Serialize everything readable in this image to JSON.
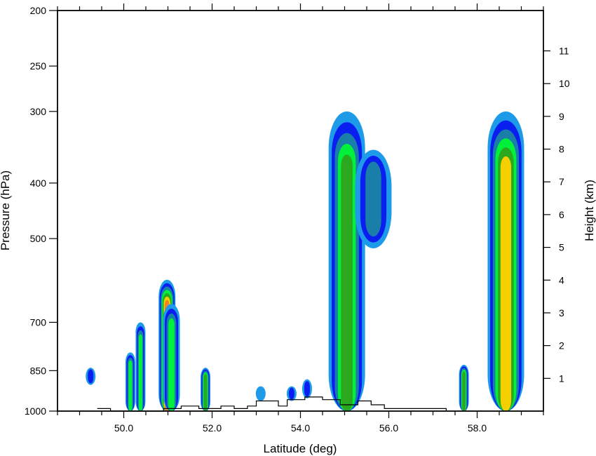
{
  "chart_data": {
    "type": "area",
    "xlabel": "Latitude (deg)",
    "ylabel": "Pressure (hPa)",
    "y2label": "Height (km)",
    "xlim": [
      48.5,
      59.5
    ],
    "ylim": [
      1000,
      200
    ],
    "y_scale": "log",
    "x_ticks": [
      "50.0",
      "52.0",
      "54.0",
      "56.0",
      "58.0"
    ],
    "x_tick_values": [
      50,
      52,
      54,
      56,
      58
    ],
    "y_ticks": [
      "200",
      "250",
      "300",
      "400",
      "500",
      "700",
      "850",
      "1000"
    ],
    "y_tick_values": [
      200,
      250,
      300,
      400,
      500,
      700,
      850,
      1000
    ],
    "y2_ticks": [
      "1",
      "2",
      "3",
      "4",
      "5",
      "6",
      "7",
      "8",
      "9",
      "10",
      "11"
    ],
    "y2_tick_values": [
      1,
      2,
      3,
      4,
      5,
      6,
      7,
      8,
      9,
      10,
      11
    ],
    "grid": false,
    "legend": "none",
    "colors": [
      "#1e9be8",
      "#0a1ef0",
      "#1a7fa8",
      "#00f03c",
      "#2ca81e",
      "#f5d000",
      "#f08228"
    ],
    "terrain_color": "#000000",
    "blobs": [
      {
        "center_lat": 49.25,
        "bottom_p": 900,
        "top_p": 840,
        "peak_level": 2
      },
      {
        "center_lat": 50.15,
        "bottom_p": 1000,
        "top_p": 790,
        "peak_level": 4
      },
      {
        "center_lat": 50.38,
        "bottom_p": 1000,
        "top_p": 700,
        "peak_level": 4
      },
      {
        "center_lat": 50.98,
        "bottom_p": 1000,
        "top_p": 590,
        "peak_level": 7
      },
      {
        "center_lat": 51.08,
        "bottom_p": 1000,
        "top_p": 650,
        "peak_level": 4
      },
      {
        "center_lat": 51.85,
        "bottom_p": 1000,
        "top_p": 840,
        "peak_level": 5
      },
      {
        "center_lat": 53.1,
        "bottom_p": 960,
        "top_p": 905,
        "peak_level": 1
      },
      {
        "center_lat": 53.8,
        "bottom_p": 960,
        "top_p": 905,
        "peak_level": 2
      },
      {
        "center_lat": 54.15,
        "bottom_p": 950,
        "top_p": 880,
        "peak_level": 2
      },
      {
        "center_lat": 55.05,
        "bottom_p": 1000,
        "top_p": 300,
        "peak_level": 5
      },
      {
        "center_lat": 55.65,
        "bottom_p": 520,
        "top_p": 350,
        "peak_level": 3
      },
      {
        "center_lat": 58.65,
        "bottom_p": 1000,
        "top_p": 300,
        "peak_level": 6
      },
      {
        "center_lat": 57.7,
        "bottom_p": 1000,
        "top_p": 830,
        "peak_level": 5
      }
    ],
    "terrain": [
      {
        "lat": 49.4,
        "p": 990
      },
      {
        "lat": 49.7,
        "p": 990
      },
      {
        "lat": 49.7,
        "p": 1000
      },
      {
        "lat": 50.9,
        "p": 1000
      },
      {
        "lat": 50.9,
        "p": 990
      },
      {
        "lat": 51.3,
        "p": 990
      },
      {
        "lat": 51.3,
        "p": 980
      },
      {
        "lat": 51.7,
        "p": 980
      },
      {
        "lat": 51.7,
        "p": 990
      },
      {
        "lat": 52.2,
        "p": 990
      },
      {
        "lat": 52.2,
        "p": 980
      },
      {
        "lat": 52.5,
        "p": 980
      },
      {
        "lat": 52.5,
        "p": 990
      },
      {
        "lat": 52.8,
        "p": 990
      },
      {
        "lat": 52.8,
        "p": 980
      },
      {
        "lat": 53.0,
        "p": 980
      },
      {
        "lat": 53.0,
        "p": 960
      },
      {
        "lat": 53.5,
        "p": 960
      },
      {
        "lat": 53.5,
        "p": 980
      },
      {
        "lat": 53.7,
        "p": 980
      },
      {
        "lat": 53.7,
        "p": 955
      },
      {
        "lat": 54.1,
        "p": 955
      },
      {
        "lat": 54.1,
        "p": 945
      },
      {
        "lat": 54.5,
        "p": 945
      },
      {
        "lat": 54.5,
        "p": 955
      },
      {
        "lat": 54.9,
        "p": 955
      },
      {
        "lat": 54.9,
        "p": 975
      },
      {
        "lat": 55.3,
        "p": 975
      },
      {
        "lat": 55.3,
        "p": 960
      },
      {
        "lat": 55.6,
        "p": 960
      },
      {
        "lat": 55.6,
        "p": 975
      },
      {
        "lat": 55.9,
        "p": 975
      },
      {
        "lat": 55.9,
        "p": 990
      },
      {
        "lat": 57.3,
        "p": 990
      },
      {
        "lat": 57.3,
        "p": 1000
      }
    ]
  }
}
